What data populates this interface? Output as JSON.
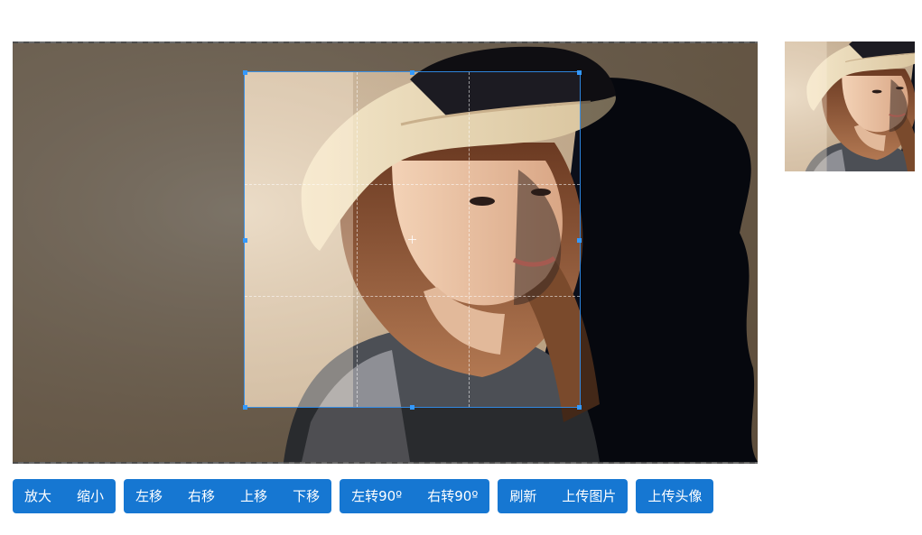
{
  "toolbar": {
    "groups": [
      {
        "buttons": [
          {
            "label": "放大"
          },
          {
            "label": "缩小"
          }
        ]
      },
      {
        "buttons": [
          {
            "label": "左移"
          },
          {
            "label": "右移"
          },
          {
            "label": "上移"
          },
          {
            "label": "下移"
          }
        ]
      },
      {
        "buttons": [
          {
            "label": "左转90º"
          },
          {
            "label": "右转90º"
          }
        ]
      },
      {
        "buttons": [
          {
            "label": "刷新"
          },
          {
            "label": "上传图片"
          }
        ]
      },
      {
        "buttons": [
          {
            "label": "上传头像"
          }
        ]
      }
    ]
  },
  "colors": {
    "accent": "#1677d2",
    "crop_outline": "#3399ff"
  }
}
